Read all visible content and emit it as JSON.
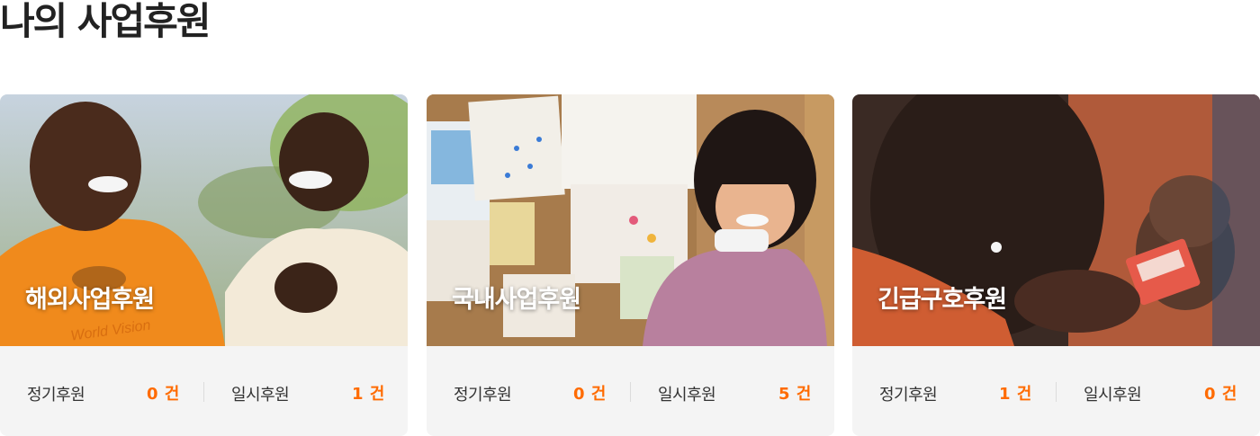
{
  "page": {
    "title": "나의 사업후원"
  },
  "cards": [
    {
      "title": "해외사업후원",
      "regular_label": "정기후원",
      "regular_value": "0 건",
      "onetime_label": "일시후원",
      "onetime_value": "1 건",
      "shirt_text": "World Vision"
    },
    {
      "title": "국내사업후원",
      "regular_label": "정기후원",
      "regular_value": "0 건",
      "onetime_label": "일시후원",
      "onetime_value": "5 건"
    },
    {
      "title": "긴급구호후원",
      "regular_label": "정기후원",
      "regular_value": "1 건",
      "onetime_label": "일시후원",
      "onetime_value": "0 건"
    }
  ],
  "colors": {
    "accent": "#ff6b00",
    "card_bg": "#f4f4f4"
  }
}
